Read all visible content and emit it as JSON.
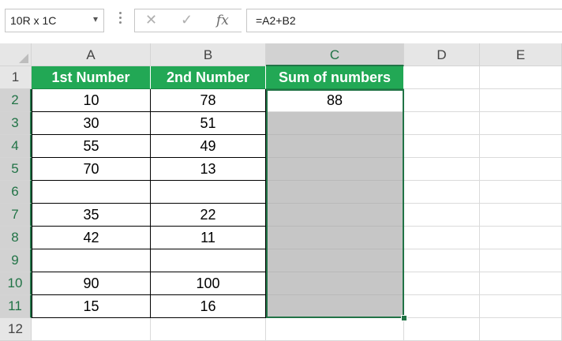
{
  "name_box": {
    "value": "10R x 1C"
  },
  "formula_bar": {
    "cancel_icon": "✕",
    "enter_icon": "✓",
    "fx_label": "fx",
    "formula": "=A2+B2"
  },
  "columns": [
    "A",
    "B",
    "C",
    "D",
    "E"
  ],
  "rows": [
    "1",
    "2",
    "3",
    "4",
    "5",
    "6",
    "7",
    "8",
    "9",
    "10",
    "11",
    "12"
  ],
  "table": {
    "headers": [
      "1st Number",
      "2nd Number",
      "Sum of numbers"
    ],
    "rows": [
      [
        "10",
        "78",
        "88"
      ],
      [
        "30",
        "51",
        ""
      ],
      [
        "55",
        "49",
        ""
      ],
      [
        "70",
        "13",
        ""
      ],
      [
        "",
        "",
        ""
      ],
      [
        "35",
        "22",
        ""
      ],
      [
        "42",
        "11",
        ""
      ],
      [
        "",
        "",
        ""
      ],
      [
        "90",
        "100",
        ""
      ],
      [
        "15",
        "16",
        ""
      ]
    ]
  },
  "colors": {
    "header_green": "#22a855",
    "selection_green": "#217346",
    "selection_fill": "#c6c6c6"
  }
}
